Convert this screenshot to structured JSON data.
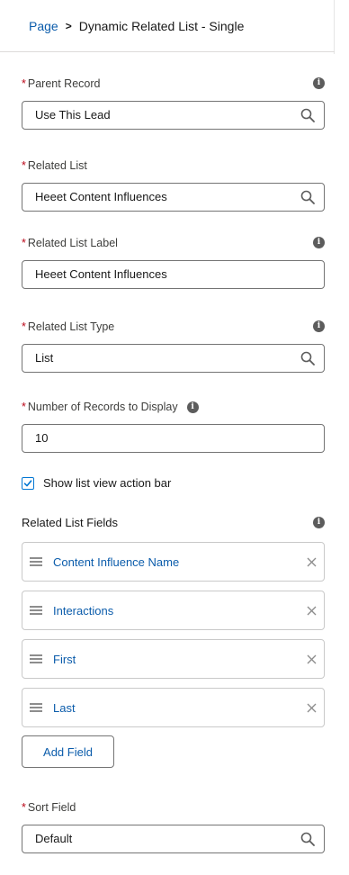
{
  "breadcrumb": {
    "root": "Page",
    "separator": ">",
    "current": "Dynamic Related List - Single"
  },
  "fields": {
    "parent_record": {
      "required_mark": "*",
      "label": "Parent Record",
      "value": "Use This Lead"
    },
    "related_list": {
      "required_mark": "*",
      "label": "Related List",
      "value": "Heeet Content Influences"
    },
    "related_list_label": {
      "required_mark": "*",
      "label": "Related List Label",
      "value": "Heeet Content Influences"
    },
    "related_list_type": {
      "required_mark": "*",
      "label": "Related List Type",
      "value": "List"
    },
    "records_to_display": {
      "required_mark": "*",
      "label": "Number of Records to Display",
      "value": "10"
    },
    "sort_field": {
      "required_mark": "*",
      "label": "Sort Field",
      "value": "Default"
    }
  },
  "show_action_bar": {
    "label": "Show list view action bar",
    "checked": true
  },
  "related_list_fields": {
    "title": "Related List Fields",
    "items": [
      {
        "label": "Content Influence Name"
      },
      {
        "label": "Interactions"
      },
      {
        "label": "First"
      },
      {
        "label": "Last"
      }
    ],
    "add_button_label": "Add Field"
  },
  "icons": {
    "info": "info-icon",
    "search": "search-icon",
    "drag": "drag-handle-icon",
    "remove": "close-icon",
    "check": "checkmark-icon"
  },
  "colors": {
    "link": "#0b5cab",
    "required": "#ba0517",
    "checkbox": "#0176d3"
  }
}
